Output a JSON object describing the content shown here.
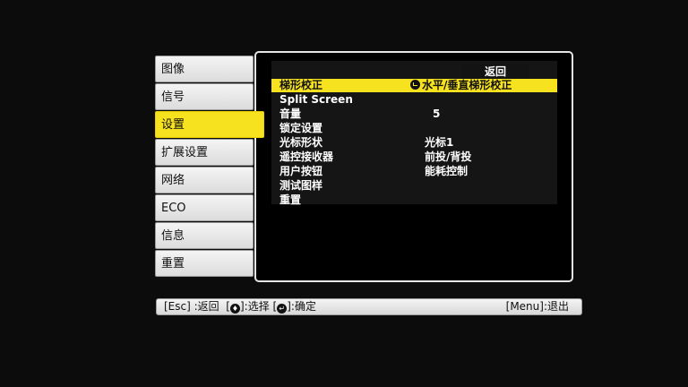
{
  "tabs": [
    "图像",
    "信号",
    "设置",
    "扩展设置",
    "网络",
    "ECO",
    "信息",
    "重置"
  ],
  "active_tab": "设置",
  "panel": {
    "return_label": "返回",
    "rows": [
      {
        "label": "梯形校正",
        "value": "水平/垂直梯形校正"
      },
      {
        "label": "Split Screen",
        "value": ""
      },
      {
        "label": "音量",
        "value": "5"
      },
      {
        "label": "锁定设置",
        "value": ""
      },
      {
        "label": "光标形状",
        "value": "光标1"
      },
      {
        "label": "遥控接收器",
        "value": "前投/背投"
      },
      {
        "label": "用户按钮",
        "value": "能耗控制"
      },
      {
        "label": "测试图样",
        "value": ""
      },
      {
        "label": "重置",
        "value": ""
      }
    ]
  },
  "help": {
    "esc": "[Esc] :返回",
    "select_prefix": "[",
    "select_suffix": "]:选择",
    "confirm_prefix": "[",
    "confirm_suffix": "]:确定",
    "menu": "[Menu]:退出",
    "select_icon": "up-down-icon",
    "confirm_icon": "enter-icon"
  },
  "colors": {
    "highlight": "#f7e21f",
    "background": "#0c0c0c"
  }
}
